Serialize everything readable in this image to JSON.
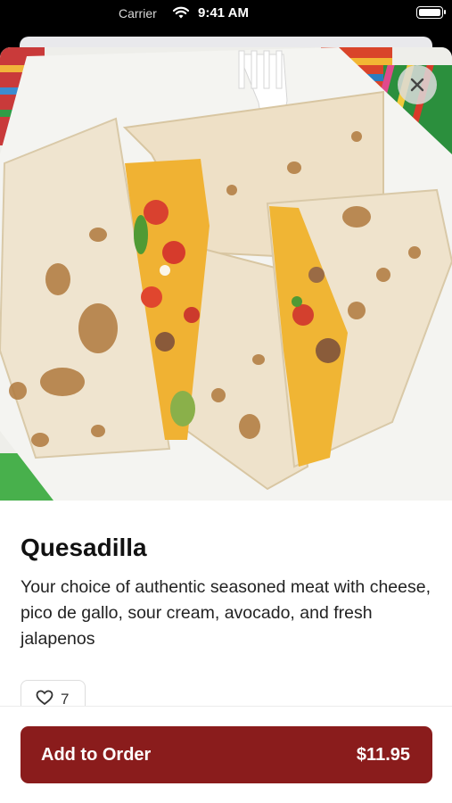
{
  "status_bar": {
    "carrier": "Carrier",
    "time": "9:41 AM"
  },
  "item": {
    "title": "Quesadilla",
    "description": "Your choice of authentic seasoned meat with cheese, pico de gallo, sour cream, avocado, and fresh jalapenos",
    "likes": "7"
  },
  "order_button": {
    "label": "Add to Order",
    "price": "$11.95"
  },
  "colors": {
    "accent": "#8a1c1c"
  }
}
